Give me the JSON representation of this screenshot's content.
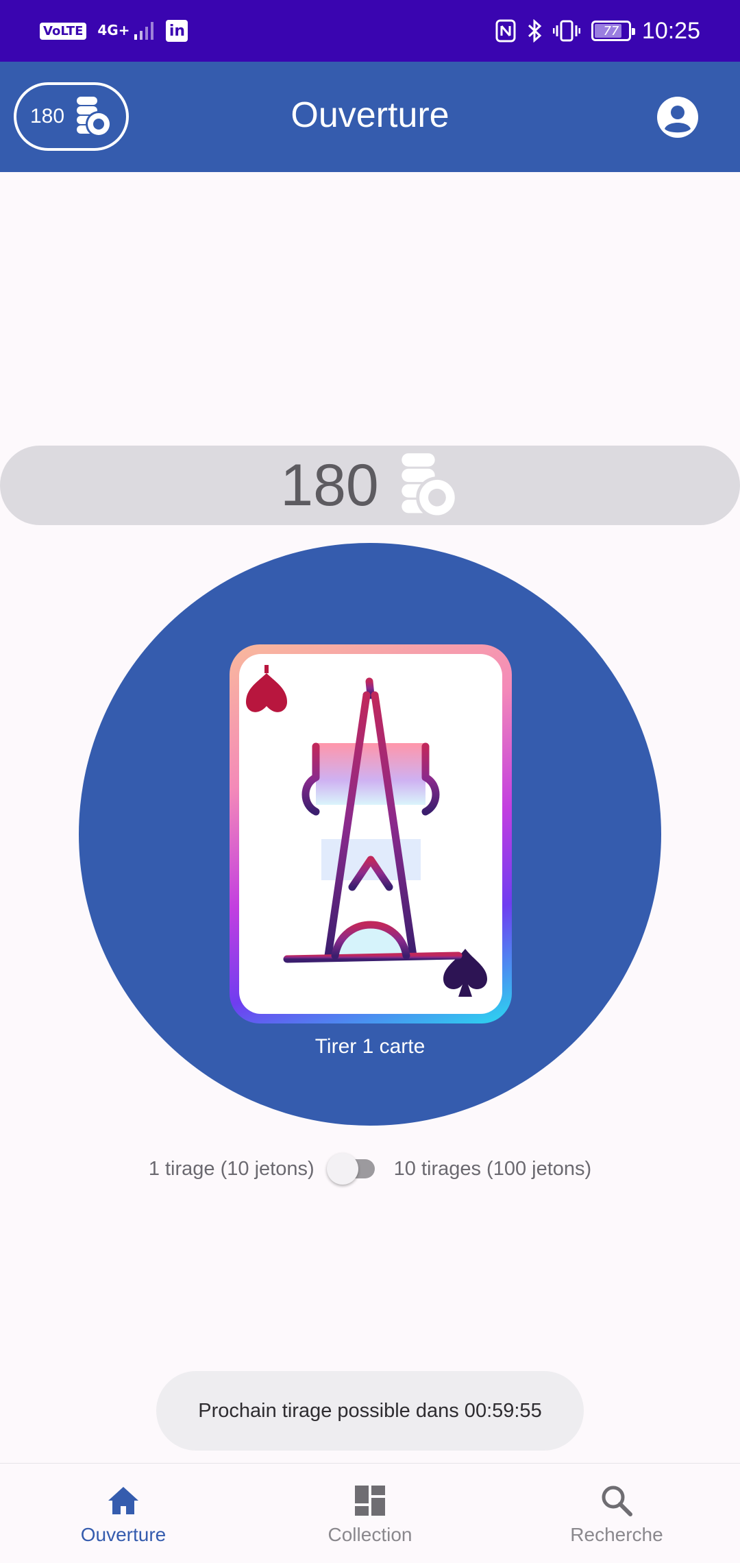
{
  "status_bar": {
    "left_icons": [
      "volte-icon",
      "4g-signal-icon",
      "linkedin-icon"
    ],
    "volte_label": "VoLTE",
    "network_label": "4G+",
    "linkedin_label": "in",
    "battery_level": "77",
    "time": "10:25"
  },
  "app_bar": {
    "token_count": "180",
    "title": "Ouverture"
  },
  "balance": {
    "value": "180"
  },
  "draw": {
    "label": "Tirer 1 carte"
  },
  "toggle": {
    "left_label": "1 tirage (10 jetons)",
    "right_label": "10 tirages (100 jetons)",
    "enabled": false
  },
  "snackbar": {
    "message": "Prochain tirage possible dans 00:59:55"
  },
  "bottom_nav": {
    "items": [
      {
        "label": "Ouverture",
        "icon": "home-icon",
        "active": true
      },
      {
        "label": "Collection",
        "icon": "dashboard-icon",
        "active": false
      },
      {
        "label": "Recherche",
        "icon": "search-icon",
        "active": false
      }
    ]
  },
  "colors": {
    "status_bar": "#3a05b0",
    "primary": "#355cae",
    "background": "#fdf9fc"
  }
}
